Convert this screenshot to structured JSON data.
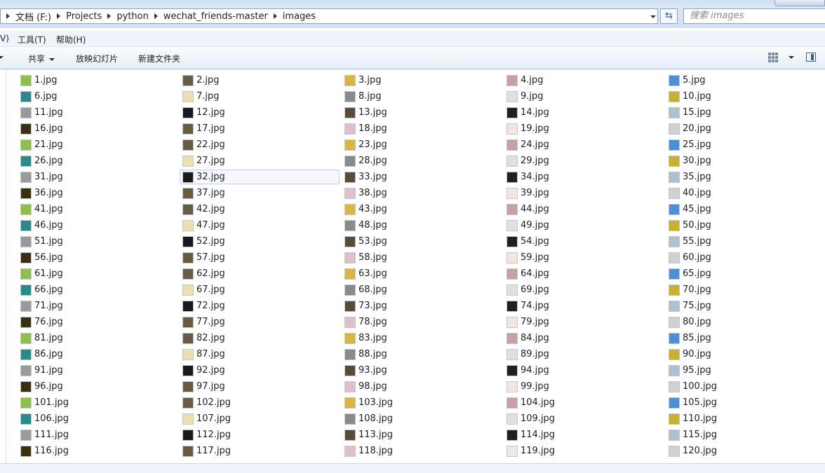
{
  "address": {
    "crumbs": [
      "文档 (F:)",
      "Projects",
      "python",
      "wechat_friends-master",
      "images"
    ],
    "search_placeholder": "搜索 images"
  },
  "menu": [
    "V)",
    "工具(T)",
    "帮助(H)"
  ],
  "commands": {
    "share": "共享",
    "slideshow": "放映幻灯片",
    "new_folder": "新建文件夹"
  },
  "colors": {
    "selection_border": "#b8d6fb",
    "selection_fill": "#f5f9fe",
    "command_bar": "#e6eef8"
  },
  "selected_file": "32.jpg",
  "files": [
    "1.jpg",
    "2.jpg",
    "3.jpg",
    "4.jpg",
    "5.jpg",
    "6.jpg",
    "7.jpg",
    "8.jpg",
    "9.jpg",
    "10.jpg",
    "11.jpg",
    "12.jpg",
    "13.jpg",
    "14.jpg",
    "15.jpg",
    "16.jpg",
    "17.jpg",
    "18.jpg",
    "19.jpg",
    "20.jpg",
    "21.jpg",
    "22.jpg",
    "23.jpg",
    "24.jpg",
    "25.jpg",
    "26.jpg",
    "27.jpg",
    "28.jpg",
    "29.jpg",
    "30.jpg",
    "31.jpg",
    "32.jpg",
    "33.jpg",
    "34.jpg",
    "35.jpg",
    "36.jpg",
    "37.jpg",
    "38.jpg",
    "39.jpg",
    "40.jpg",
    "41.jpg",
    "42.jpg",
    "43.jpg",
    "44.jpg",
    "45.jpg",
    "46.jpg",
    "47.jpg",
    "48.jpg",
    "49.jpg",
    "50.jpg",
    "51.jpg",
    "52.jpg",
    "53.jpg",
    "54.jpg",
    "55.jpg",
    "56.jpg",
    "57.jpg",
    "58.jpg",
    "59.jpg",
    "60.jpg",
    "61.jpg",
    "62.jpg",
    "63.jpg",
    "64.jpg",
    "65.jpg",
    "66.jpg",
    "67.jpg",
    "68.jpg",
    "69.jpg",
    "70.jpg",
    "71.jpg",
    "72.jpg",
    "73.jpg",
    "74.jpg",
    "75.jpg",
    "76.jpg",
    "77.jpg",
    "78.jpg",
    "79.jpg",
    "80.jpg",
    "81.jpg",
    "82.jpg",
    "83.jpg",
    "84.jpg",
    "85.jpg",
    "86.jpg",
    "87.jpg",
    "88.jpg",
    "89.jpg",
    "90.jpg",
    "91.jpg",
    "92.jpg",
    "93.jpg",
    "94.jpg",
    "95.jpg",
    "96.jpg",
    "97.jpg",
    "98.jpg",
    "99.jpg",
    "100.jpg",
    "101.jpg",
    "102.jpg",
    "103.jpg",
    "104.jpg",
    "105.jpg",
    "106.jpg",
    "107.jpg",
    "108.jpg",
    "109.jpg",
    "110.jpg",
    "111.jpg",
    "112.jpg",
    "113.jpg",
    "114.jpg",
    "115.jpg",
    "116.jpg",
    "117.jpg",
    "118.jpg",
    "119.jpg",
    "120.jpg"
  ]
}
